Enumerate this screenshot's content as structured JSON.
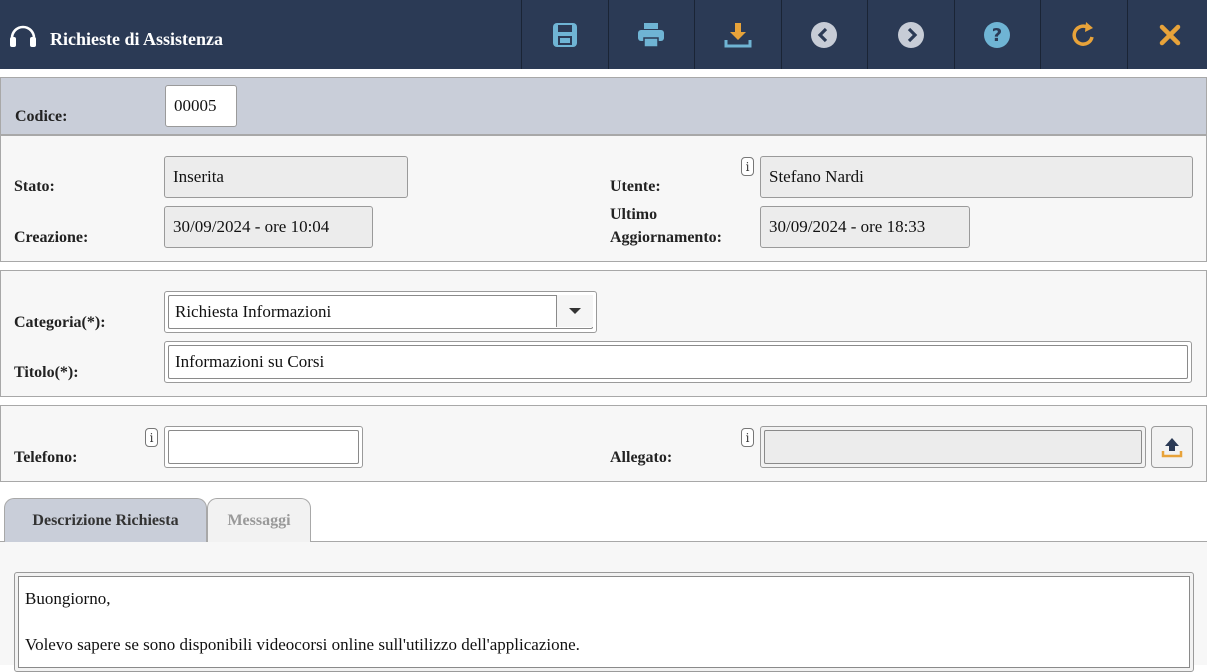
{
  "header": {
    "title": "Richieste di Assistenza",
    "icon": "headset-icon",
    "bg_color": "#2b3a55",
    "toolbar": [
      {
        "name": "save-button",
        "icon": "save-icon"
      },
      {
        "name": "print-button",
        "icon": "print-icon"
      },
      {
        "name": "download-button",
        "icon": "download-icon"
      },
      {
        "name": "previous-button",
        "icon": "chevron-left-icon"
      },
      {
        "name": "next-button",
        "icon": "chevron-right-icon"
      },
      {
        "name": "help-button",
        "icon": "question-icon"
      },
      {
        "name": "refresh-button",
        "icon": "refresh-icon"
      },
      {
        "name": "close-button",
        "icon": "close-icon"
      }
    ]
  },
  "code": {
    "label": "Codice:",
    "value": "00005"
  },
  "status": {
    "stato_label": "Stato:",
    "stato_value": "Inserita",
    "utente_label": "Utente:",
    "utente_value": "Stefano Nardi",
    "creazione_label": "Creazione:",
    "creazione_value": "30/09/2024 - ore 10:04",
    "ultimo_label_1": "Ultimo",
    "ultimo_label_2": "Aggiornamento:",
    "ultimo_value": "30/09/2024 - ore 18:33",
    "info_glyph": "i"
  },
  "request": {
    "categoria_label": "Categoria(*):",
    "categoria_value": "Richiesta Informazioni",
    "titolo_label": "Titolo(*):",
    "titolo_value": "Informazioni su Corsi"
  },
  "contact": {
    "telefono_label": "Telefono:",
    "telefono_value": "",
    "allegato_label": "Allegato:",
    "allegato_value": "",
    "info_glyph": "i"
  },
  "tabs": [
    {
      "label": "Descrizione Richiesta",
      "active": true
    },
    {
      "label": "Messaggi",
      "active": false
    }
  ],
  "description": {
    "line1": "Buongiorno,",
    "line2": "Volevo sapere se sono disponibili videocorsi online sull'utilizzo dell'applicazione."
  },
  "colors": {
    "accent_blue": "#6fb4d4",
    "accent_orange": "#e8a33a",
    "panel_grey": "#c9ced9"
  }
}
